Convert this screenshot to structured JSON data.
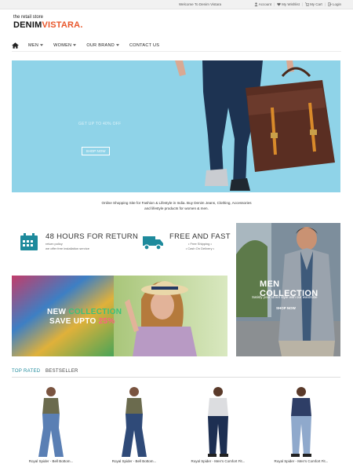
{
  "topbar": {
    "welcome": "Welcome To Denim Vistara",
    "links": [
      "Account",
      "My Wishlist",
      "My Cart",
      "Login"
    ]
  },
  "logo": {
    "tagline": "the retail store",
    "brand_main": "DENIM",
    "brand_accent": "VISTARA."
  },
  "nav": {
    "items": [
      "MEN",
      "WOMEN",
      "OUR BRAND",
      "CONTACT US"
    ]
  },
  "hero": {
    "offer": "GET UP TO 40% OFF",
    "button": "SHOP NOW"
  },
  "intro": {
    "line1": "Online Shopping Site for Fashion & Lifestyle in India. Buy Denim Jeans, Clothing, Accessories",
    "line2": "and lifestyle products for women & men."
  },
  "features": [
    {
      "title": "48 HOURS FOR RETURN",
      "sub1": "return policy",
      "sub2": "we offer free installation service"
    },
    {
      "title": "FREE AND FAST",
      "sub1": "• Free Shipping •",
      "sub2": "• Cash On Delivery •"
    }
  ],
  "men_banner": {
    "title": "MEN COLLECTION",
    "desc": "Satisfy your street style with our wardrobe",
    "button": "SHOP NOW"
  },
  "promo": {
    "line1_a": "NEW ",
    "line1_b": "COLLECTION",
    "line2_a": "SAVE UPTO ",
    "line2_b": "25%"
  },
  "tabs": [
    "TOP RATED",
    "BESTSELLER"
  ],
  "products": [
    {
      "name": "Royal Spider - Bell Bottom..."
    },
    {
      "name": "Royal Spider - Bell Bottom..."
    },
    {
      "name": "Royal Spider - Men's Comfort Fit..."
    },
    {
      "name": "Royal Spider - Men's Comfort Fit..."
    }
  ],
  "colors": {
    "accent": "#e8562a",
    "teal": "#1e8a9c",
    "hero_bg": "#8fd3e8",
    "green": "#3cc07a",
    "pink": "#ff5f86"
  }
}
